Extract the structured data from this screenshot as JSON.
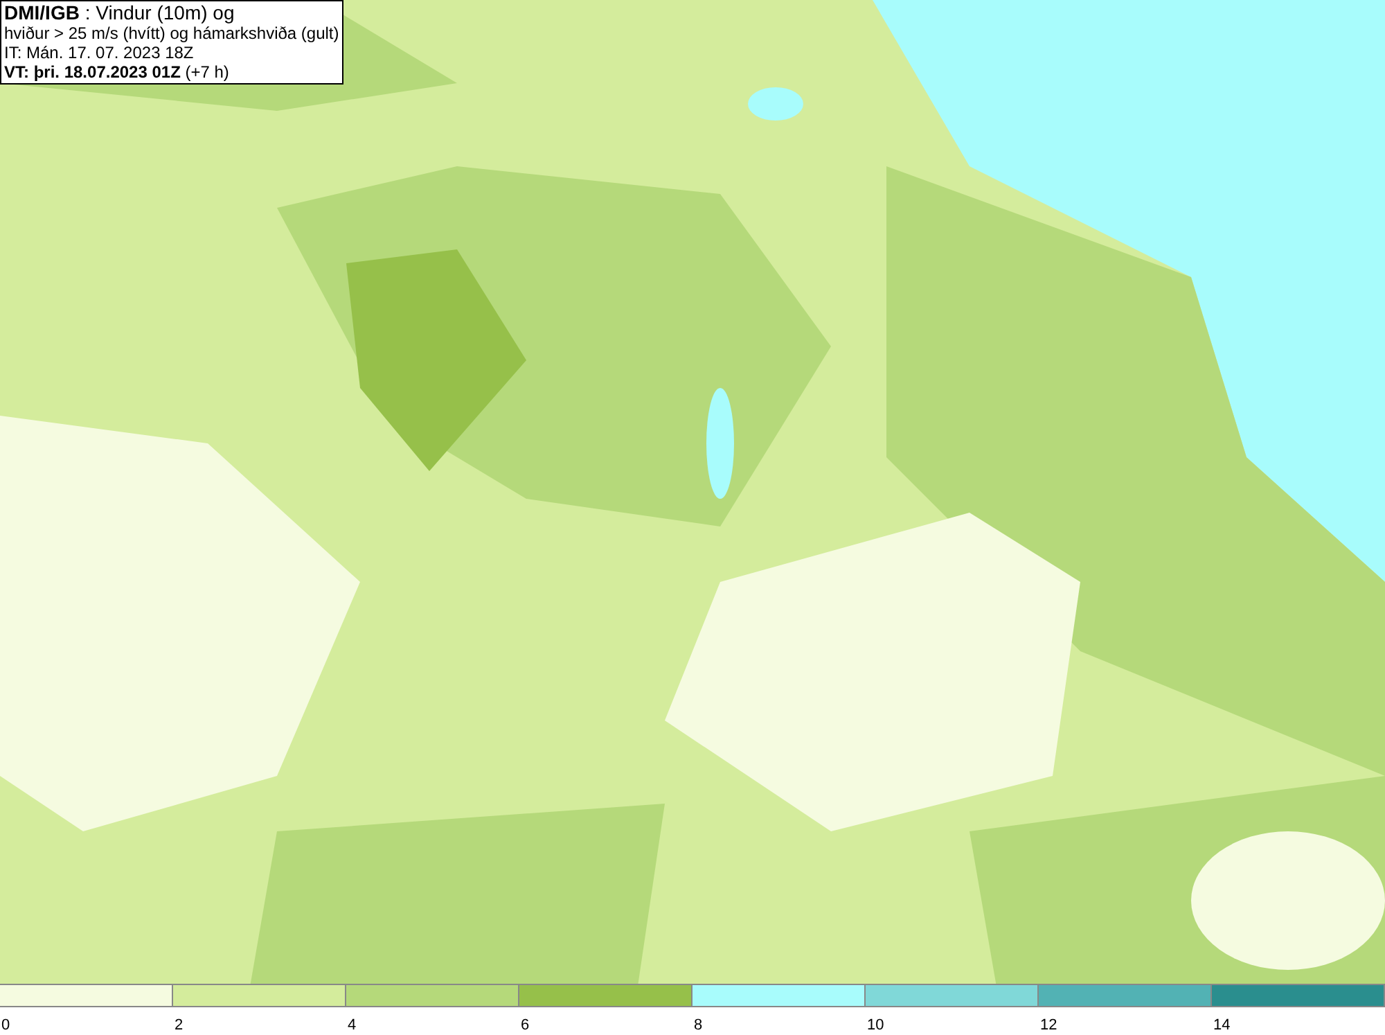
{
  "title_box": {
    "lines": [
      "**DMI/IGB** : Vindur (10m) og",
      "hviður > 25 m/s (hvítt) og hámarkshviða (gult)",
      "IT: Mán. 17. 07. 2023 18Z",
      "**VT: þri. 18.07.2023 01Z** (+7 h)"
    ]
  },
  "legend": {
    "bins": [
      {
        "color": "#f5fbe0"
      },
      {
        "color": "#d4ec9c"
      },
      {
        "color": "#b5d97a"
      },
      {
        "color": "#96c04a"
      },
      {
        "color": "#a8fcfc"
      },
      {
        "color": "#80d8d8"
      },
      {
        "color": "#52b2b4"
      },
      {
        "color": "#2a8e8e"
      }
    ],
    "ticks": [
      "0",
      "2",
      "4",
      "6",
      "8",
      "10",
      "12",
      "14"
    ]
  }
}
